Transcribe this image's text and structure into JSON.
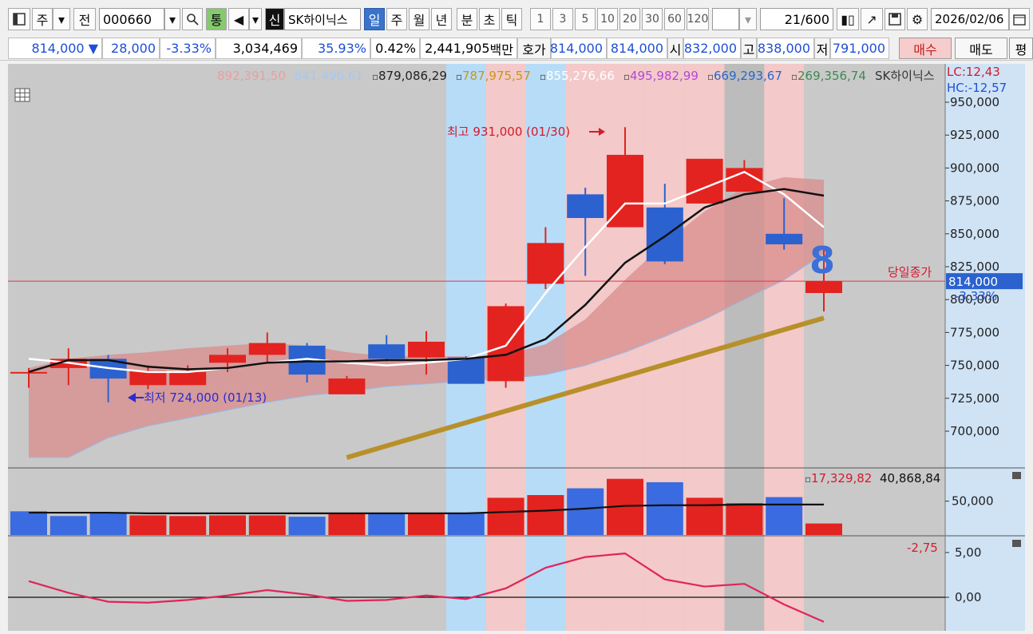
{
  "toolbar": {
    "period_label": "주",
    "prev_label": "전",
    "stock_code": "000660",
    "type_label": "통",
    "credit_label": "신",
    "stock_name": "SK하이닉스",
    "periods": [
      "일",
      "주",
      "월",
      "년",
      "분",
      "초",
      "틱"
    ],
    "active_period": "일",
    "intervals": [
      "1",
      "3",
      "5",
      "10",
      "20",
      "30",
      "60",
      "120"
    ],
    "count": "21",
    "count_total": "/600",
    "date": "2026/02/06"
  },
  "quote": {
    "price": "814,000",
    "change": "28,000",
    "change_pct": "-3.33%",
    "volume": "3,034,469",
    "vol_ratio": "35.93%",
    "turnover": "0.42%",
    "amount": "2,441,905",
    "amount_unit": "백만",
    "bid_label": "호가",
    "bid1": "814,000",
    "bid2": "814,000",
    "open_label": "시",
    "open": "832,000",
    "high_label": "고",
    "high": "838,000",
    "low_label": "저",
    "low": "791,000",
    "buy_label": "매수",
    "sell_label": "매도",
    "eval_label": "평"
  },
  "chart_data": [
    {
      "type": "candlestick",
      "ylim": [
        680000,
        960000
      ],
      "yticks": [
        "950,000",
        "925,000",
        "900,000",
        "875,000",
        "850,000",
        "825,000",
        "800,000",
        "775,000",
        "750,000",
        "725,000",
        "700,000"
      ],
      "ytick_values": [
        950000,
        925000,
        900000,
        875000,
        850000,
        825000,
        800000,
        775000,
        750000,
        725000,
        700000
      ],
      "candles": [
        {
          "o": 745000,
          "c": 745000,
          "h": 748000,
          "l": 733000,
          "up": true
        },
        {
          "o": 748000,
          "c": 755000,
          "h": 763000,
          "l": 735000,
          "up": true
        },
        {
          "o": 755000,
          "c": 740000,
          "h": 758000,
          "l": 722000,
          "up": false
        },
        {
          "o": 735000,
          "c": 746000,
          "h": 750000,
          "l": 732000,
          "up": true
        },
        {
          "o": 735000,
          "c": 745000,
          "h": 750000,
          "l": 735000,
          "up": true
        },
        {
          "o": 752000,
          "c": 758000,
          "h": 763000,
          "l": 745000,
          "up": true
        },
        {
          "o": 758000,
          "c": 767000,
          "h": 775000,
          "l": 752000,
          "up": true
        },
        {
          "o": 765000,
          "c": 743000,
          "h": 767000,
          "l": 737000,
          "up": false
        },
        {
          "o": 728000,
          "c": 740000,
          "h": 742000,
          "l": 728000,
          "up": true
        },
        {
          "o": 766000,
          "c": 755000,
          "h": 773000,
          "l": 753000,
          "up": false
        },
        {
          "o": 756000,
          "c": 768000,
          "h": 776000,
          "l": 743000,
          "up": true
        },
        {
          "o": 756000,
          "c": 736000,
          "h": 757000,
          "l": 736000,
          "up": false
        },
        {
          "o": 738000,
          "c": 795000,
          "h": 797000,
          "l": 733000,
          "up": true
        },
        {
          "o": 812000,
          "c": 843000,
          "h": 855000,
          "l": 808000,
          "up": true
        },
        {
          "o": 880000,
          "c": 862000,
          "h": 885000,
          "l": 818000,
          "up": false
        },
        {
          "o": 855000,
          "c": 910000,
          "h": 931000,
          "l": 855000,
          "up": true
        },
        {
          "o": 870000,
          "c": 829000,
          "h": 888000,
          "l": 827000,
          "up": false
        },
        {
          "o": 873000,
          "c": 907000,
          "h": 907000,
          "l": 873000,
          "up": true
        },
        {
          "o": 882000,
          "c": 900000,
          "h": 906000,
          "l": 882000,
          "up": true
        },
        {
          "o": 850000,
          "c": 842000,
          "h": 877000,
          "l": 838000,
          "up": false
        },
        {
          "o": 805000,
          "c": 814000,
          "h": 838000,
          "l": 791000,
          "up": true
        }
      ],
      "ma_white": [
        755000,
        752000,
        748000,
        745000,
        745000,
        748000,
        752000,
        755000,
        752000,
        750000,
        752000,
        755000,
        765000,
        805000,
        840000,
        873000,
        873000,
        885000,
        897000,
        880000,
        855000
      ],
      "ma_black": [
        745000,
        754000,
        754000,
        749000,
        747000,
        748000,
        752000,
        753000,
        753000,
        754000,
        754000,
        755000,
        758000,
        770000,
        796000,
        828000,
        848000,
        870000,
        880000,
        884000,
        879000
      ],
      "band_upper": [
        748000,
        755000,
        758000,
        760000,
        763000,
        765000,
        767000,
        765000,
        760000,
        757000,
        757000,
        757000,
        758000,
        766000,
        785000,
        815000,
        843000,
        867000,
        885000,
        893000,
        891000
      ],
      "band_lower": [
        680000,
        680000,
        695000,
        704000,
        710000,
        716000,
        722000,
        727000,
        730000,
        734000,
        736000,
        738000,
        740000,
        743000,
        750000,
        760000,
        772000,
        785000,
        800000,
        815000,
        835000
      ],
      "trend_line": {
        "x0": 8,
        "y0": 680000,
        "x1": 20,
        "y1": 786000
      },
      "highlights": [
        {
          "i": 11,
          "color": "#b7dcf7"
        },
        {
          "i": 12,
          "color": "#f3c9c9"
        },
        {
          "i": 13,
          "color": "#b7dcf7"
        },
        {
          "i": 14,
          "color": "#f3c9c9"
        },
        {
          "i": 15,
          "color": "#f3c9c9"
        },
        {
          "i": 16,
          "color": "#f3c9c9"
        },
        {
          "i": 17,
          "color": "#f3c9c9"
        },
        {
          "i": 18,
          "color": "#bcbcbc"
        },
        {
          "i": 19,
          "color": "#f3c9c9"
        }
      ],
      "legend": [
        {
          "text": "892,391,50",
          "color": "#e8a0a0"
        },
        {
          "text": "841,496,61",
          "color": "#a8c8ef"
        },
        {
          "text": "879,086,29",
          "color": "#222222"
        },
        {
          "text": "787,975,57",
          "color": "#c8951c"
        },
        {
          "text": "855,276,66",
          "color": "#ffffff"
        },
        {
          "text": "495,982,99",
          "color": "#b449d6"
        },
        {
          "text": "669,293,67",
          "color": "#2a67c9"
        },
        {
          "text": "269,356,74",
          "color": "#3d8a4e"
        },
        {
          "text": "SK하이닉스",
          "color": "#333333"
        }
      ],
      "lc_label": "LC:12,43",
      "hc_label": "HC:-12,57",
      "max_annot": "최고 931,000 (01/30)",
      "min_annot": "최저 724,000 (01/13)",
      "close_line_label": "당일종가",
      "close_value": 814000,
      "close_price_label": "814,000",
      "close_pct_label": "-3.33%",
      "signal_badge": "8"
    },
    {
      "type": "bar",
      "name": "volume",
      "legend_values": [
        "17,329,82",
        "40,868,84"
      ],
      "ytick": "50,000",
      "values": [
        35,
        28,
        33,
        29,
        28,
        29,
        29,
        27,
        33,
        31,
        31,
        32,
        55,
        59,
        69,
        83,
        78,
        55,
        47,
        56,
        17
      ],
      "colors": [
        "blue",
        "blue",
        "blue",
        "red",
        "red",
        "red",
        "red",
        "blue",
        "red",
        "blue",
        "red",
        "blue",
        "red",
        "red",
        "blue",
        "red",
        "blue",
        "red",
        "red",
        "blue",
        "red"
      ],
      "ma": [
        33,
        33,
        33,
        32,
        32,
        32,
        32,
        32,
        32,
        32,
        32,
        32,
        34,
        36,
        39,
        43,
        44,
        44,
        45,
        45,
        45
      ]
    },
    {
      "type": "line",
      "name": "oscillator",
      "legend_value": "-2,75",
      "yticks": [
        "5,00",
        "0,00"
      ],
      "values": [
        1.8,
        0.5,
        -0.5,
        -0.6,
        -0.3,
        0.2,
        0.8,
        0.3,
        -0.4,
        -0.3,
        0.2,
        -0.2,
        1.0,
        3.3,
        4.5,
        4.9,
        2.0,
        1.2,
        1.5,
        -0.8,
        -2.75
      ]
    }
  ]
}
